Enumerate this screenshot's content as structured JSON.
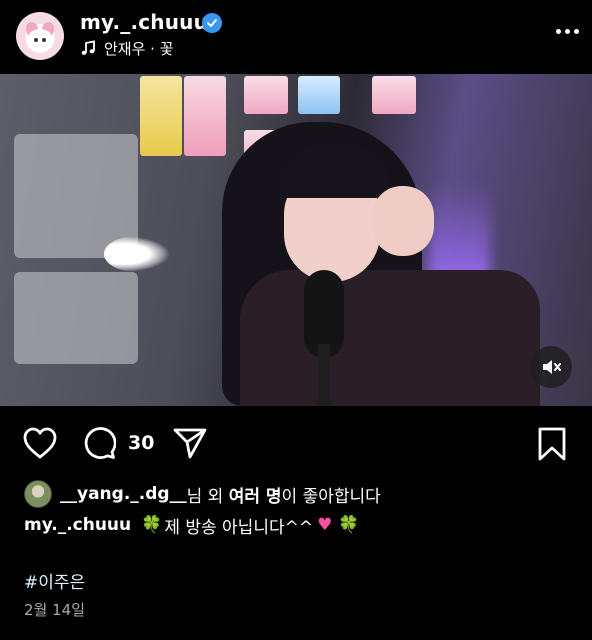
{
  "header": {
    "username": "my._.chuuu",
    "song": "안재우 · 꽃",
    "icons": [
      "avatar",
      "verified-badge",
      "music-note-icon",
      "more-icon"
    ]
  },
  "media": {
    "icons": [
      "mute-icon"
    ]
  },
  "actions": {
    "comment_count": "30",
    "icons": [
      "heart-icon",
      "comment-icon",
      "share-icon",
      "bookmark-icon"
    ]
  },
  "likes": {
    "user": "__yang._.dg__",
    "text_mid": "님 외 ",
    "others": "여러 명",
    "text_end": "이 좋아합니다"
  },
  "caption": {
    "username": "my._.chuuu",
    "text_part1": "제 방송 아닙니다^^",
    "emojis": [
      "four-leaf-clover",
      "pink-heart",
      "four-leaf-clover"
    ]
  },
  "hashtag": "#이주은",
  "date": "2월 14일",
  "colors": {
    "background": "#000000",
    "verified": "#3897f0",
    "muted_text": "#a8a8a8"
  }
}
